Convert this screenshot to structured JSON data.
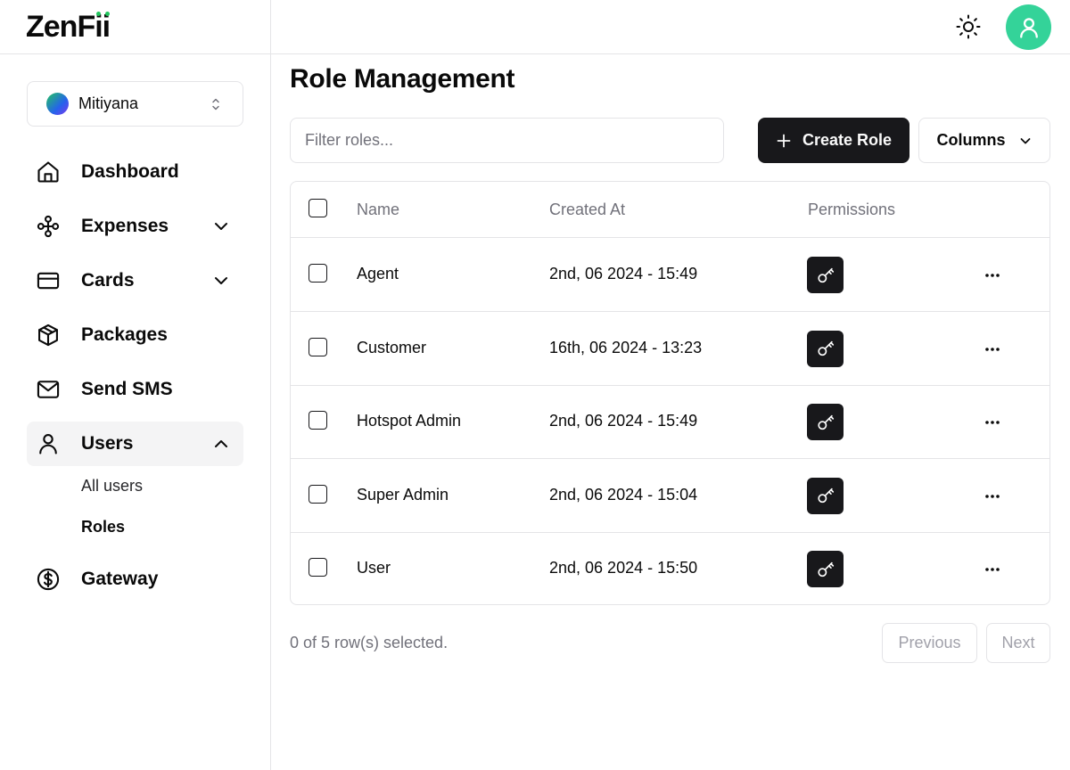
{
  "brand": {
    "name_main": "ZenF",
    "name_tail": "ii",
    "accent_color": "#22c55e"
  },
  "org": {
    "name": "Mitiyana"
  },
  "nav": {
    "items": [
      {
        "label": "Dashboard",
        "icon": "home-icon"
      },
      {
        "label": "Expenses",
        "icon": "workflow-icon",
        "expandable": true
      },
      {
        "label": "Cards",
        "icon": "credit-card-icon",
        "expandable": true
      },
      {
        "label": "Packages",
        "icon": "package-icon"
      },
      {
        "label": "Send SMS",
        "icon": "mail-icon"
      },
      {
        "label": "Users",
        "icon": "user-icon",
        "expandable": true,
        "expanded": true,
        "active": true
      },
      {
        "label": "Gateway",
        "icon": "dollar-circle-icon"
      }
    ],
    "users_sub": [
      {
        "label": "All users",
        "active": false
      },
      {
        "label": "Roles",
        "active": true
      }
    ]
  },
  "header": {
    "theme_icon": "sun-icon",
    "avatar_icon": "user-icon",
    "avatar_color": "#34d399"
  },
  "page": {
    "title": "Role Management",
    "filter_placeholder": "Filter roles...",
    "create_label": "Create Role",
    "columns_label": "Columns"
  },
  "table": {
    "headers": {
      "name": "Name",
      "created": "Created At",
      "permissions": "Permissions"
    },
    "rows": [
      {
        "name": "Agent",
        "created": "2nd, 06 2024 - 15:49"
      },
      {
        "name": "Customer",
        "created": "16th, 06 2024 - 13:23"
      },
      {
        "name": "Hotspot Admin",
        "created": "2nd, 06 2024 - 15:49"
      },
      {
        "name": "Super Admin",
        "created": "2nd, 06 2024 - 15:04"
      },
      {
        "name": "User",
        "created": "2nd, 06 2024 - 15:50"
      }
    ]
  },
  "footer": {
    "selection": "0 of 5 row(s) selected.",
    "previous": "Previous",
    "next": "Next"
  }
}
